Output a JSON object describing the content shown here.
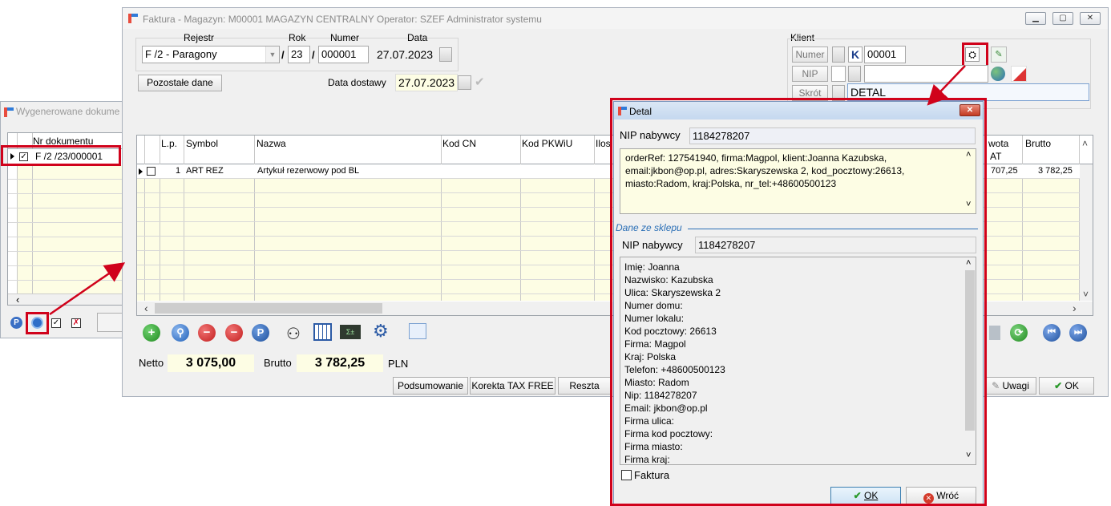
{
  "left_window": {
    "title": "Wygenerowane dokume",
    "column_header": "Nr dokumentu",
    "row_value": "F /2  /23/000001"
  },
  "main_window": {
    "title": "Faktura - Magazyn: M00001 MAGAZYN CENTRALNY  Operator: SZEF Administrator systemu",
    "rejestr_label": "Rejestr",
    "rok_label": "Rok",
    "numer_label": "Numer",
    "data_label": "Data",
    "rejestr_value": "F /2  - Paragony",
    "rok_value": "23",
    "numer_value": "000001",
    "data_value": "27.07.2023",
    "slash": "/",
    "pozostale_button": "Pozostałe dane",
    "data_dostawy_label": "Data dostawy",
    "data_dostawy_value": "27.07.2023",
    "klient_label": "Klient",
    "numer_button": "Numer",
    "k_letter": "K",
    "klient_numer_value": "00001",
    "nip_button": "NIP",
    "skrot_button": "Skrót",
    "skrot_value": "DETAL",
    "table": {
      "columns": {
        "lp": "L.p.",
        "symbol": "Symbol",
        "nazwa": "Nazwa",
        "kodcn": "Kod CN",
        "pkwiu": "Kod PKWiU",
        "ilosc": "Ilos",
        "kwota1": "wota",
        "kwota2": "AT",
        "brutto": "Brutto"
      },
      "row": {
        "lp": "1",
        "symbol": "ART REZ",
        "nazwa": "Artykuł rezerwowy pod BL",
        "kwota": "707,25",
        "brutto": "3 782,25"
      }
    },
    "netto_label": "Netto",
    "netto_value": "3 075,00",
    "brutto_label": "Brutto",
    "brutto_value": "3 782,25",
    "currency": "PLN",
    "podsumowanie_button": "Podsumowanie",
    "korekta_button": "Korekta TAX FREE",
    "reszta_button": "Reszta",
    "uwagi_button": "Uwagi",
    "ok_button": "OK"
  },
  "dialog": {
    "title": "Detal",
    "nip_label": "NIP nabywcy",
    "nip_value": "1184278207",
    "memo_lines": [
      "orderRef: 127541940, firma:Magpol, klient:Joanna Kazubska,",
      "email:jkbon@op.pl, adres:Skaryszewska 2, kod_pocztowy:26613,",
      "miasto:Radom, kraj:Polska, nr_tel:+48600500123"
    ],
    "group_label": "Dane ze sklepu",
    "nip2_label": "NIP nabywcy",
    "nip2_value": "1184278207",
    "details": [
      "Imię: Joanna",
      "Nazwisko: Kazubska",
      "Ulica: Skaryszewska 2",
      "Numer domu:",
      "Numer lokalu:",
      "Kod pocztowy: 26613",
      "Firma: Magpol",
      "Kraj: Polska",
      "Telefon: +48600500123",
      "Miasto: Radom",
      "Nip: 1184278207",
      "Email: jkbon@op.pl",
      "Firma ulica:",
      "Firma kod pocztowy:",
      "Firma miasto:",
      "Firma kraj:"
    ],
    "faktura_label": "Faktura",
    "ok_button": "OK",
    "wroc_button": "Wróć"
  },
  "colors": {
    "accent_red": "#d0021b",
    "field_yellow": "#fdfde4",
    "dialog_title_blue": "#cfe0f3",
    "group_blue": "#2b6fb6"
  }
}
